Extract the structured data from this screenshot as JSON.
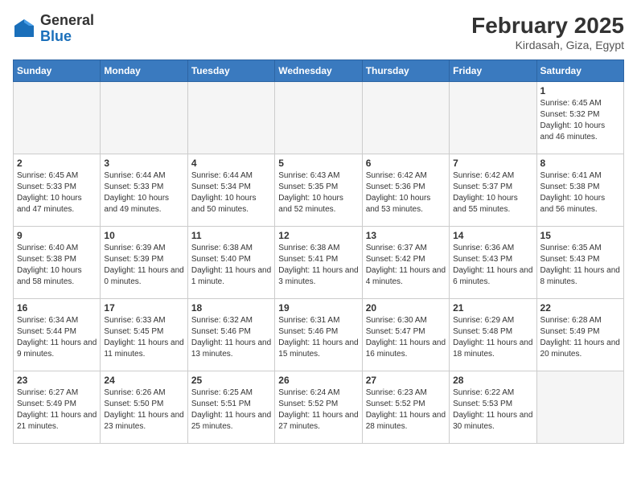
{
  "header": {
    "logo_general": "General",
    "logo_blue": "Blue",
    "month_title": "February 2025",
    "location": "Kirdasah, Giza, Egypt"
  },
  "weekdays": [
    "Sunday",
    "Monday",
    "Tuesday",
    "Wednesday",
    "Thursday",
    "Friday",
    "Saturday"
  ],
  "weeks": [
    [
      {
        "day": "",
        "text": ""
      },
      {
        "day": "",
        "text": ""
      },
      {
        "day": "",
        "text": ""
      },
      {
        "day": "",
        "text": ""
      },
      {
        "day": "",
        "text": ""
      },
      {
        "day": "",
        "text": ""
      },
      {
        "day": "1",
        "text": "Sunrise: 6:45 AM\nSunset: 5:32 PM\nDaylight: 10 hours and 46 minutes."
      }
    ],
    [
      {
        "day": "2",
        "text": "Sunrise: 6:45 AM\nSunset: 5:33 PM\nDaylight: 10 hours and 47 minutes."
      },
      {
        "day": "3",
        "text": "Sunrise: 6:44 AM\nSunset: 5:33 PM\nDaylight: 10 hours and 49 minutes."
      },
      {
        "day": "4",
        "text": "Sunrise: 6:44 AM\nSunset: 5:34 PM\nDaylight: 10 hours and 50 minutes."
      },
      {
        "day": "5",
        "text": "Sunrise: 6:43 AM\nSunset: 5:35 PM\nDaylight: 10 hours and 52 minutes."
      },
      {
        "day": "6",
        "text": "Sunrise: 6:42 AM\nSunset: 5:36 PM\nDaylight: 10 hours and 53 minutes."
      },
      {
        "day": "7",
        "text": "Sunrise: 6:42 AM\nSunset: 5:37 PM\nDaylight: 10 hours and 55 minutes."
      },
      {
        "day": "8",
        "text": "Sunrise: 6:41 AM\nSunset: 5:38 PM\nDaylight: 10 hours and 56 minutes."
      }
    ],
    [
      {
        "day": "9",
        "text": "Sunrise: 6:40 AM\nSunset: 5:38 PM\nDaylight: 10 hours and 58 minutes."
      },
      {
        "day": "10",
        "text": "Sunrise: 6:39 AM\nSunset: 5:39 PM\nDaylight: 11 hours and 0 minutes."
      },
      {
        "day": "11",
        "text": "Sunrise: 6:38 AM\nSunset: 5:40 PM\nDaylight: 11 hours and 1 minute."
      },
      {
        "day": "12",
        "text": "Sunrise: 6:38 AM\nSunset: 5:41 PM\nDaylight: 11 hours and 3 minutes."
      },
      {
        "day": "13",
        "text": "Sunrise: 6:37 AM\nSunset: 5:42 PM\nDaylight: 11 hours and 4 minutes."
      },
      {
        "day": "14",
        "text": "Sunrise: 6:36 AM\nSunset: 5:43 PM\nDaylight: 11 hours and 6 minutes."
      },
      {
        "day": "15",
        "text": "Sunrise: 6:35 AM\nSunset: 5:43 PM\nDaylight: 11 hours and 8 minutes."
      }
    ],
    [
      {
        "day": "16",
        "text": "Sunrise: 6:34 AM\nSunset: 5:44 PM\nDaylight: 11 hours and 9 minutes."
      },
      {
        "day": "17",
        "text": "Sunrise: 6:33 AM\nSunset: 5:45 PM\nDaylight: 11 hours and 11 minutes."
      },
      {
        "day": "18",
        "text": "Sunrise: 6:32 AM\nSunset: 5:46 PM\nDaylight: 11 hours and 13 minutes."
      },
      {
        "day": "19",
        "text": "Sunrise: 6:31 AM\nSunset: 5:46 PM\nDaylight: 11 hours and 15 minutes."
      },
      {
        "day": "20",
        "text": "Sunrise: 6:30 AM\nSunset: 5:47 PM\nDaylight: 11 hours and 16 minutes."
      },
      {
        "day": "21",
        "text": "Sunrise: 6:29 AM\nSunset: 5:48 PM\nDaylight: 11 hours and 18 minutes."
      },
      {
        "day": "22",
        "text": "Sunrise: 6:28 AM\nSunset: 5:49 PM\nDaylight: 11 hours and 20 minutes."
      }
    ],
    [
      {
        "day": "23",
        "text": "Sunrise: 6:27 AM\nSunset: 5:49 PM\nDaylight: 11 hours and 21 minutes."
      },
      {
        "day": "24",
        "text": "Sunrise: 6:26 AM\nSunset: 5:50 PM\nDaylight: 11 hours and 23 minutes."
      },
      {
        "day": "25",
        "text": "Sunrise: 6:25 AM\nSunset: 5:51 PM\nDaylight: 11 hours and 25 minutes."
      },
      {
        "day": "26",
        "text": "Sunrise: 6:24 AM\nSunset: 5:52 PM\nDaylight: 11 hours and 27 minutes."
      },
      {
        "day": "27",
        "text": "Sunrise: 6:23 AM\nSunset: 5:52 PM\nDaylight: 11 hours and 28 minutes."
      },
      {
        "day": "28",
        "text": "Sunrise: 6:22 AM\nSunset: 5:53 PM\nDaylight: 11 hours and 30 minutes."
      },
      {
        "day": "",
        "text": ""
      }
    ]
  ]
}
